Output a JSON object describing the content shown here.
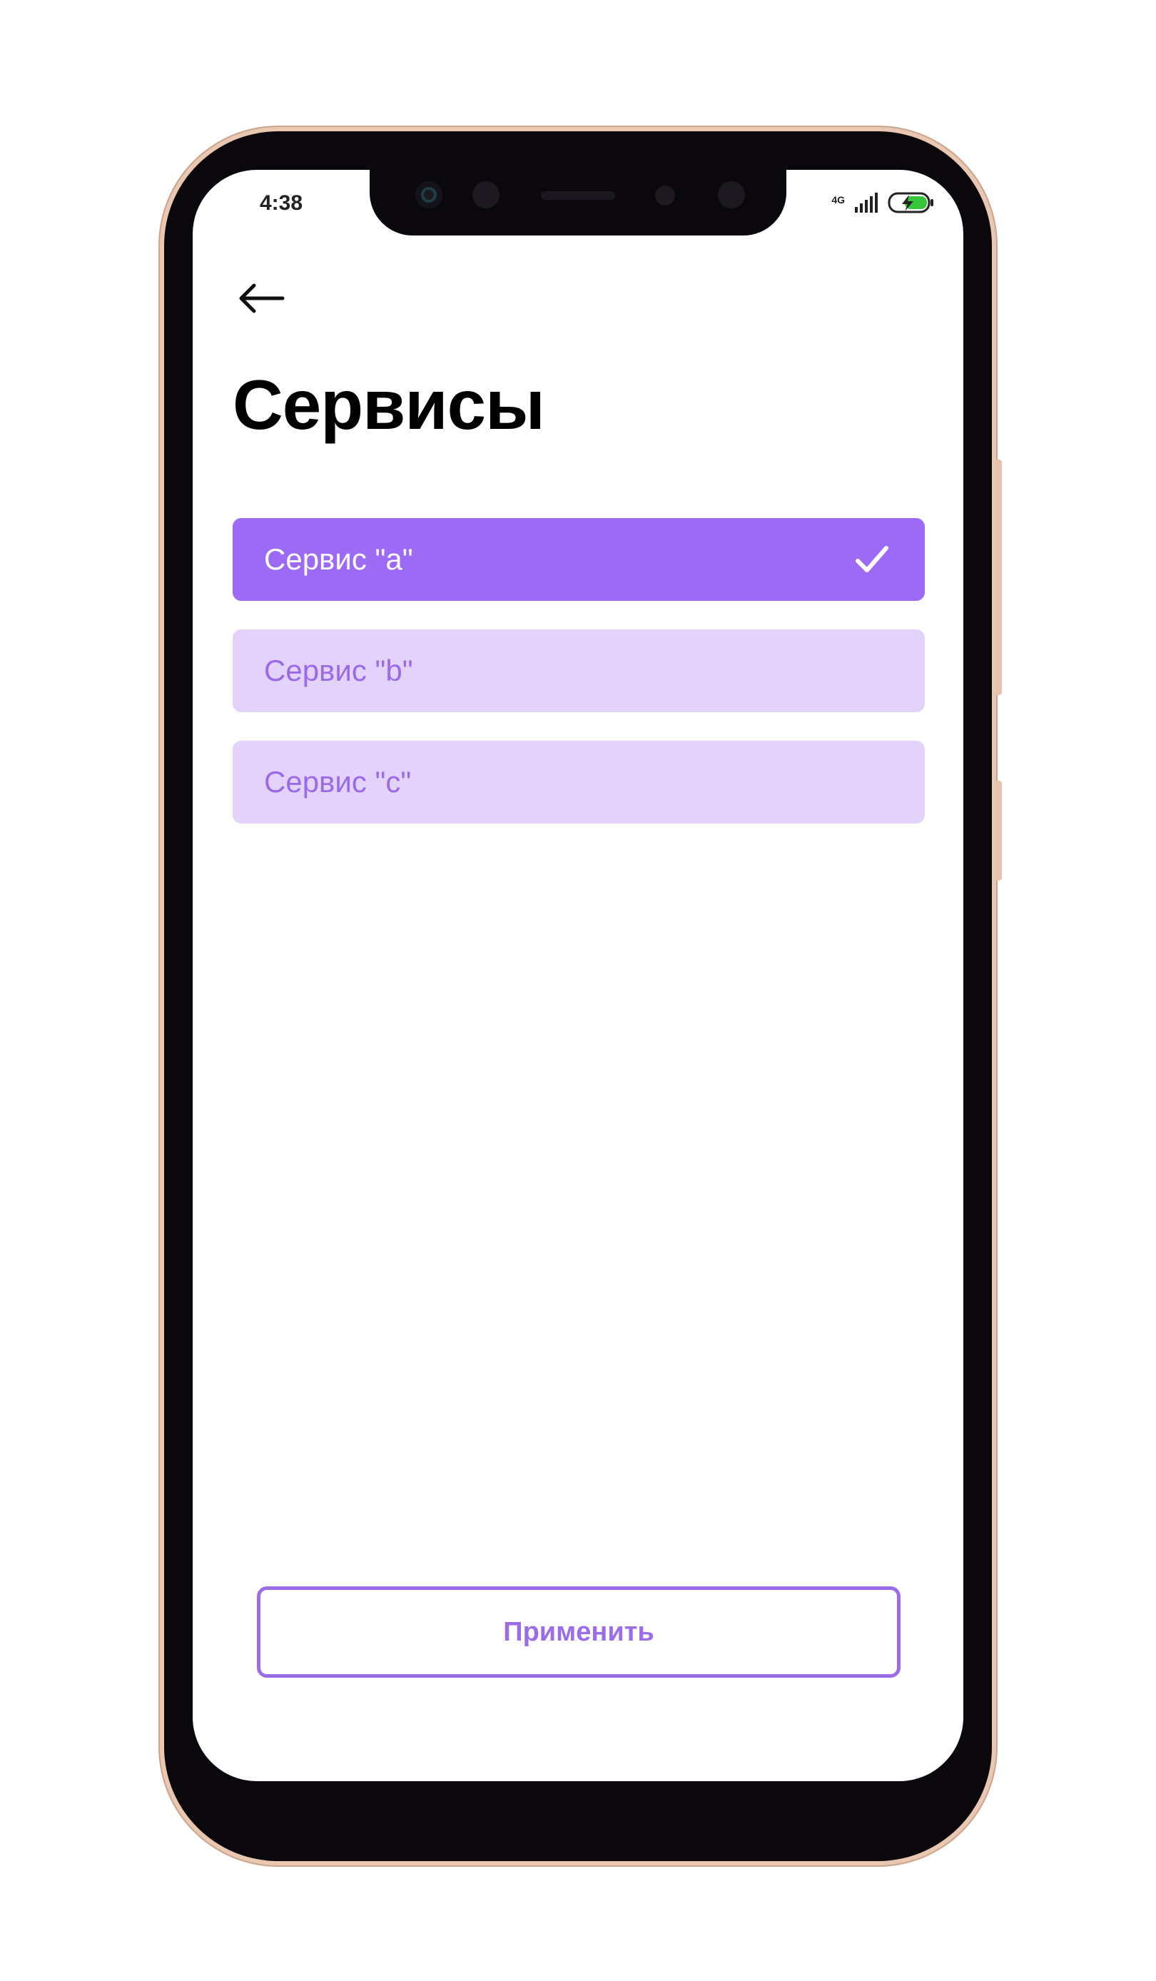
{
  "status_bar": {
    "time": "4:38",
    "network_label": "4G"
  },
  "header": {
    "title": "Сервисы"
  },
  "services": [
    {
      "label": "Сервис \"a\"",
      "selected": true
    },
    {
      "label": "Сервис \"b\"",
      "selected": false
    },
    {
      "label": "Сервис \"c\"",
      "selected": false
    }
  ],
  "footer": {
    "apply_label": "Применить"
  },
  "colors": {
    "accent": "#9d6af5",
    "accent_light": "#e3d3fb",
    "accent_text": "#9b6ae6",
    "battery_charge": "#37c53c"
  }
}
